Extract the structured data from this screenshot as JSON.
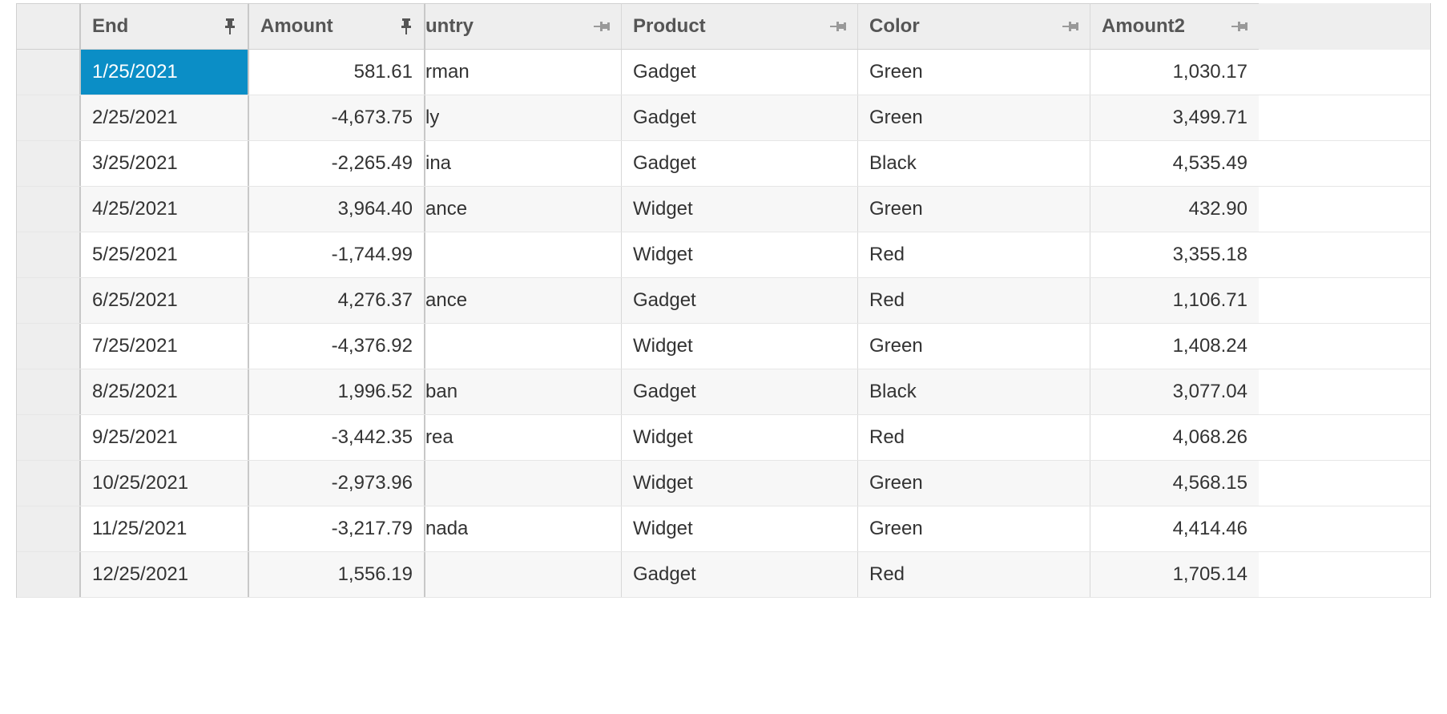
{
  "columns": {
    "end": {
      "label": "End",
      "pinned": true
    },
    "amount": {
      "label": "Amount",
      "pinned": true
    },
    "country": {
      "label": "untry",
      "pinned": false
    },
    "product": {
      "label": "Product",
      "pinned": false
    },
    "color": {
      "label": "Color",
      "pinned": false
    },
    "amount2": {
      "label": "Amount2",
      "pinned": false
    }
  },
  "rows": [
    {
      "end": "1/25/2021",
      "amount": "581.61",
      "country": "rman",
      "product": "Gadget",
      "color": "Green",
      "amount2": "1,030.17",
      "selected": true
    },
    {
      "end": "2/25/2021",
      "amount": "-4,673.75",
      "country": "ly",
      "product": "Gadget",
      "color": "Green",
      "amount2": "3,499.71",
      "selected": false
    },
    {
      "end": "3/25/2021",
      "amount": "-2,265.49",
      "country": "ina",
      "product": "Gadget",
      "color": "Black",
      "amount2": "4,535.49",
      "selected": false
    },
    {
      "end": "4/25/2021",
      "amount": "3,964.40",
      "country": "ance",
      "product": "Widget",
      "color": "Green",
      "amount2": "432.90",
      "selected": false
    },
    {
      "end": "5/25/2021",
      "amount": "-1,744.99",
      "country": "",
      "product": "Widget",
      "color": "Red",
      "amount2": "3,355.18",
      "selected": false
    },
    {
      "end": "6/25/2021",
      "amount": "4,276.37",
      "country": "ance",
      "product": "Gadget",
      "color": "Red",
      "amount2": "1,106.71",
      "selected": false
    },
    {
      "end": "7/25/2021",
      "amount": "-4,376.92",
      "country": "",
      "product": "Widget",
      "color": "Green",
      "amount2": "1,408.24",
      "selected": false
    },
    {
      "end": "8/25/2021",
      "amount": "1,996.52",
      "country": "ban",
      "product": "Gadget",
      "color": "Black",
      "amount2": "3,077.04",
      "selected": false
    },
    {
      "end": "9/25/2021",
      "amount": "-3,442.35",
      "country": "rea",
      "product": "Widget",
      "color": "Red",
      "amount2": "4,068.26",
      "selected": false
    },
    {
      "end": "10/25/2021",
      "amount": "-2,973.96",
      "country": "",
      "product": "Widget",
      "color": "Green",
      "amount2": "4,568.15",
      "selected": false
    },
    {
      "end": "11/25/2021",
      "amount": "-3,217.79",
      "country": "nada",
      "product": "Widget",
      "color": "Green",
      "amount2": "4,414.46",
      "selected": false
    },
    {
      "end": "12/25/2021",
      "amount": "1,556.19",
      "country": "",
      "product": "Gadget",
      "color": "Red",
      "amount2": "1,705.14",
      "selected": false
    }
  ]
}
